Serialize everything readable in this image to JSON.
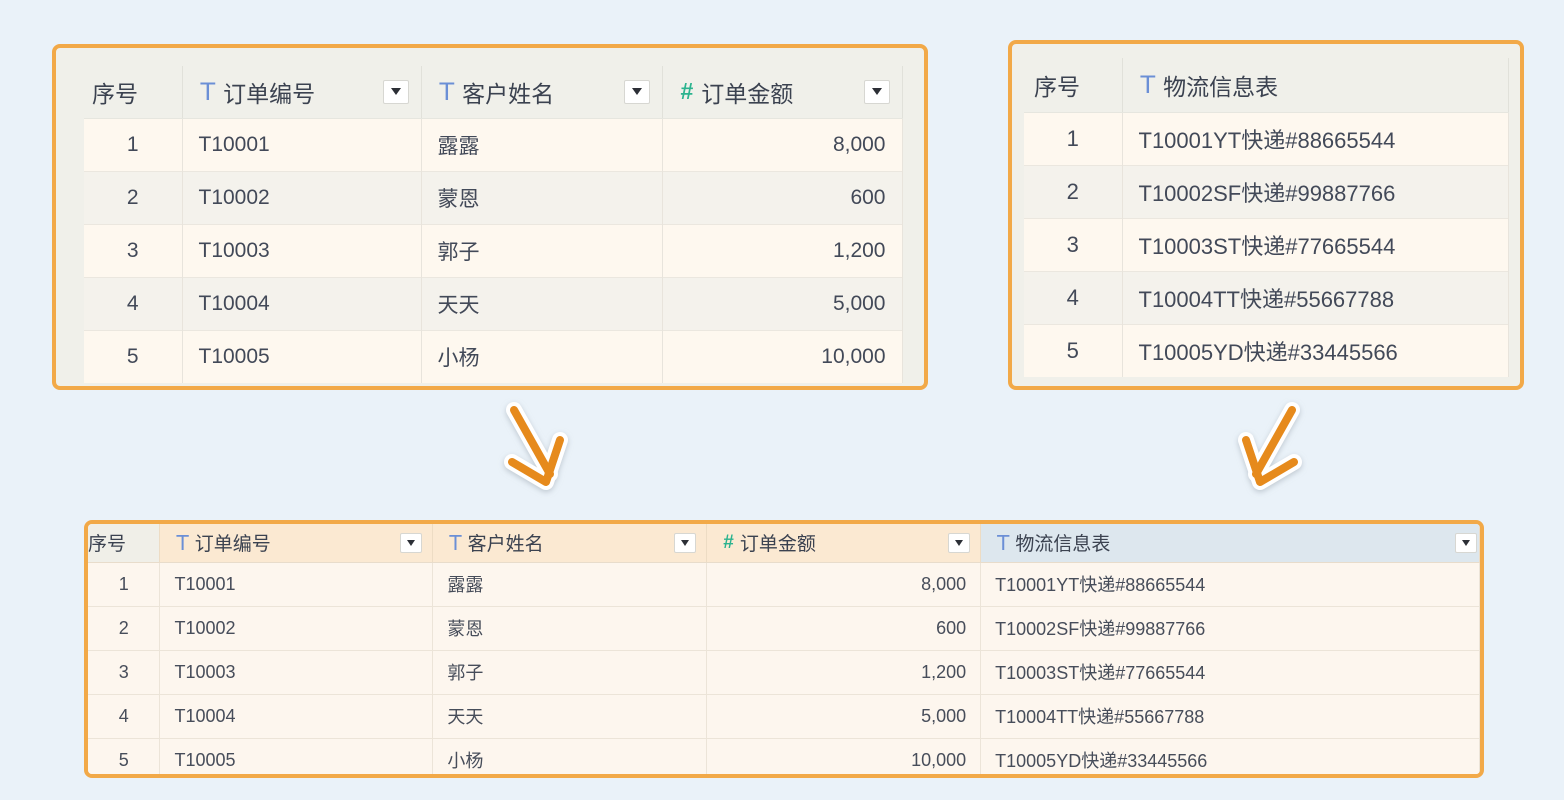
{
  "colors": {
    "page_bg": "#eaf2f9",
    "panel_border": "#f2a948",
    "arrow": "#e68a1a",
    "text_icon": "#6b8fd6",
    "number_icon": "#2bb38f"
  },
  "orders_table": {
    "headers": [
      {
        "label": "序号",
        "icon": "none",
        "dropdown": false
      },
      {
        "label": "订单编号",
        "icon": "text-type-icon",
        "dropdown": true
      },
      {
        "label": "客户姓名",
        "icon": "text-type-icon",
        "dropdown": true
      },
      {
        "label": "订单金额",
        "icon": "number-type-icon",
        "dropdown": true
      }
    ],
    "rows": [
      [
        "1",
        "T10001",
        "露露",
        "8,000"
      ],
      [
        "2",
        "T10002",
        "蒙恩",
        "600"
      ],
      [
        "3",
        "T10003",
        "郭子",
        "1,200"
      ],
      [
        "4",
        "T10004",
        "天天",
        "5,000"
      ],
      [
        "5",
        "T10005",
        "小杨",
        "10,000"
      ]
    ]
  },
  "logistics_table": {
    "headers": [
      {
        "label": "序号",
        "icon": "none"
      },
      {
        "label": "物流信息表",
        "icon": "text-type-icon"
      }
    ],
    "rows": [
      [
        "1",
        "T10001YT快递#88665544"
      ],
      [
        "2",
        "T10002SF快递#99887766"
      ],
      [
        "3",
        "T10003ST快递#77665544"
      ],
      [
        "4",
        "T10004TT快递#55667788"
      ],
      [
        "5",
        "T10005YD快递#33445566"
      ]
    ]
  },
  "merged_table": {
    "headers": [
      {
        "label": "序号",
        "icon": "none",
        "dropdown": false
      },
      {
        "label": "订单编号",
        "icon": "text-type-icon",
        "dropdown": true
      },
      {
        "label": "客户姓名",
        "icon": "text-type-icon",
        "dropdown": true
      },
      {
        "label": "订单金额",
        "icon": "number-type-icon",
        "dropdown": true
      },
      {
        "label": "物流信息表",
        "icon": "text-type-icon",
        "dropdown": true
      }
    ],
    "rows": [
      [
        "1",
        "T10001",
        "露露",
        "8,000",
        "T10001YT快递#88665544"
      ],
      [
        "2",
        "T10002",
        "蒙恩",
        "600",
        "T10002SF快递#99887766"
      ],
      [
        "3",
        "T10003",
        "郭子",
        "1,200",
        "T10003ST快递#77665544"
      ],
      [
        "4",
        "T10004",
        "天天",
        "5,000",
        "T10004TT快递#55667788"
      ],
      [
        "5",
        "T10005",
        "小杨",
        "10,000",
        "T10005YD快递#33445566"
      ]
    ]
  },
  "icons": {
    "text_type": "T",
    "number_type": "#"
  }
}
